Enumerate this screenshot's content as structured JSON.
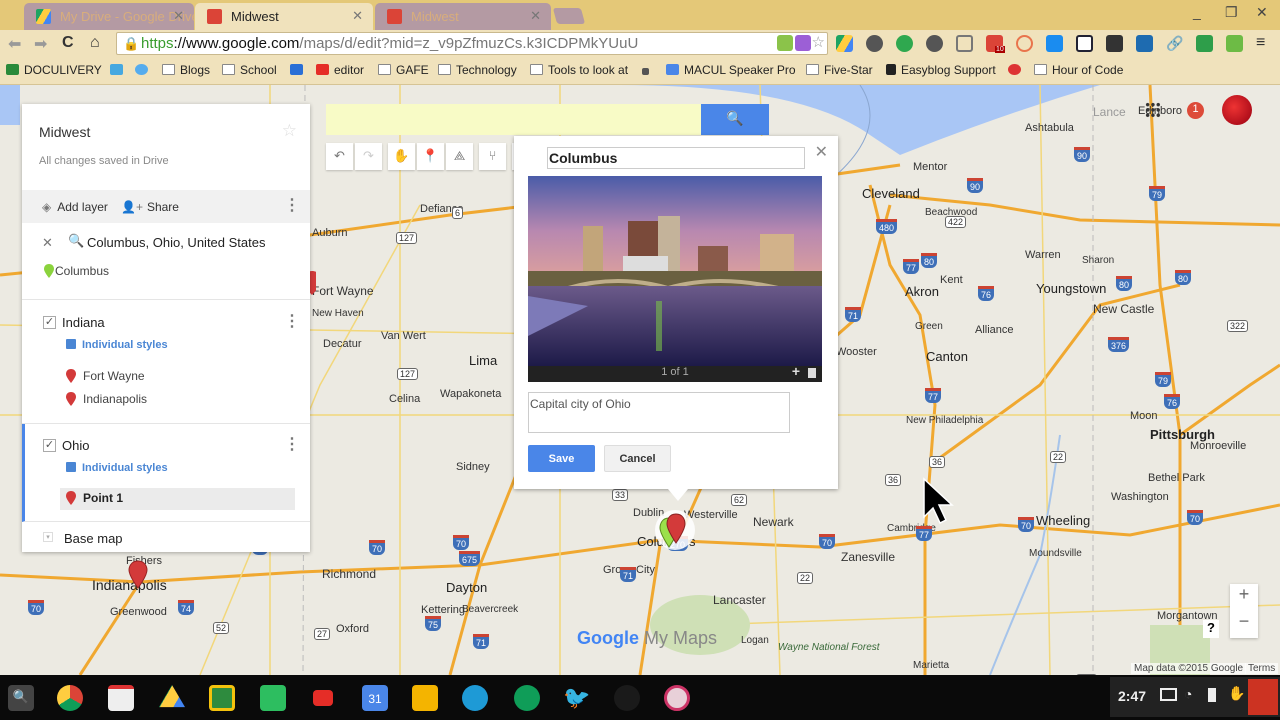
{
  "browser": {
    "tabs": [
      {
        "title": "My Drive - Google Drive",
        "active": false,
        "favicon": "google-drive-icon"
      },
      {
        "title": "Midwest",
        "active": true,
        "favicon": "google-my-maps-icon"
      },
      {
        "title": "Midwest",
        "active": false,
        "favicon": "google-my-maps-icon"
      }
    ],
    "url": {
      "scheme": "https",
      "host": "://www.google.com",
      "path": "/maps/d/edit?mid=z_v9pZfmuzCs.k3ICDPMkYUuU"
    },
    "bookmarks": [
      {
        "label": "DOCULIVERY",
        "icon": "doculivery-icon"
      },
      {
        "label": "",
        "icon": "kahoot-icon"
      },
      {
        "label": "",
        "icon": "twitter-icon"
      },
      {
        "label": "Blogs",
        "icon": "folder-icon"
      },
      {
        "label": "School",
        "icon": "folder-icon"
      },
      {
        "label": "",
        "icon": "four-icon"
      },
      {
        "label": "editor",
        "icon": "youtube-icon"
      },
      {
        "label": "GAFE",
        "icon": "folder-icon"
      },
      {
        "label": "Technology",
        "icon": "folder-icon"
      },
      {
        "label": "Tools to look at",
        "icon": "folder-icon"
      },
      {
        "label": "MACUL Speaker Pro",
        "icon": "docs-icon"
      },
      {
        "label": "Five-Star",
        "icon": "folder-icon"
      },
      {
        "label": "Easyblog Support",
        "icon": "easyblog-icon"
      },
      {
        "label": "Hour of Code",
        "icon": "folder-icon"
      }
    ],
    "extension_badge": "10"
  },
  "panel": {
    "title": "Midwest",
    "subtitle": "All changes saved in Drive",
    "add_layer": "Add layer",
    "share": "Share",
    "search_query": "Columbus, Ohio, United States",
    "search_result": "Columbus",
    "layers": [
      {
        "name": "Indiana",
        "checked": true,
        "style": "Individual styles",
        "places": [
          "Fort Wayne",
          "Indianapolis"
        ]
      },
      {
        "name": "Ohio",
        "checked": true,
        "style": "Individual styles",
        "places": [
          "Point 1"
        ]
      }
    ],
    "base_map": "Base map"
  },
  "search": {
    "value": "",
    "placeholder": ""
  },
  "infowindow": {
    "title": "Columbus",
    "photo_caption": "1 of 1",
    "description": "Capital city of Ohio",
    "save": "Save",
    "cancel": "Cancel"
  },
  "map": {
    "notifications": "1",
    "attribution": "Map data ©2015 Google",
    "terms": "Terms",
    "logo_google": "Google",
    "logo_mymaps": "My Maps",
    "labels": [
      "Cleveland",
      "Mentor",
      "Ashtabula",
      "Beachwood",
      "Akron",
      "Kent",
      "Warren",
      "Sharon",
      "Youngstown",
      "New Castle",
      "Green",
      "Alliance",
      "Canton",
      "Wooster",
      "New Philadelphia",
      "Pittsburgh",
      "Moon",
      "Bethel Park",
      "Washington",
      "Monroeville",
      "Wheeling",
      "Moundsville",
      "Cambridge",
      "Zanesville",
      "Newark",
      "Dublin",
      "Westerville",
      "Columbus",
      "Grove City",
      "Lancaster",
      "Logan",
      "Wayne National Forest",
      "Marietta",
      "Morgantown",
      "Dayton",
      "Kettering",
      "Beavercreek",
      "Richmond",
      "Oxford",
      "Indianapolis",
      "Greenwood",
      "Fishers",
      "Fort Wayne",
      "New Haven",
      "Decatur",
      "Van Wert",
      "Lima",
      "Celina",
      "Wapakoneta",
      "Sidney",
      "Defiance",
      "Auburn",
      "Lance",
      "Edinboro"
    ]
  },
  "taskbar": {
    "time": "2:47",
    "apps": [
      "search-icon",
      "chrome-icon",
      "gmail-icon",
      "drive-icon",
      "classroom-icon",
      "evernote-icon",
      "youtube-icon",
      "calendar-icon",
      "keep-icon",
      "files-icon",
      "hangouts-icon",
      "twitter-icon",
      "dark-app-icon",
      "camera-app-icon"
    ]
  }
}
